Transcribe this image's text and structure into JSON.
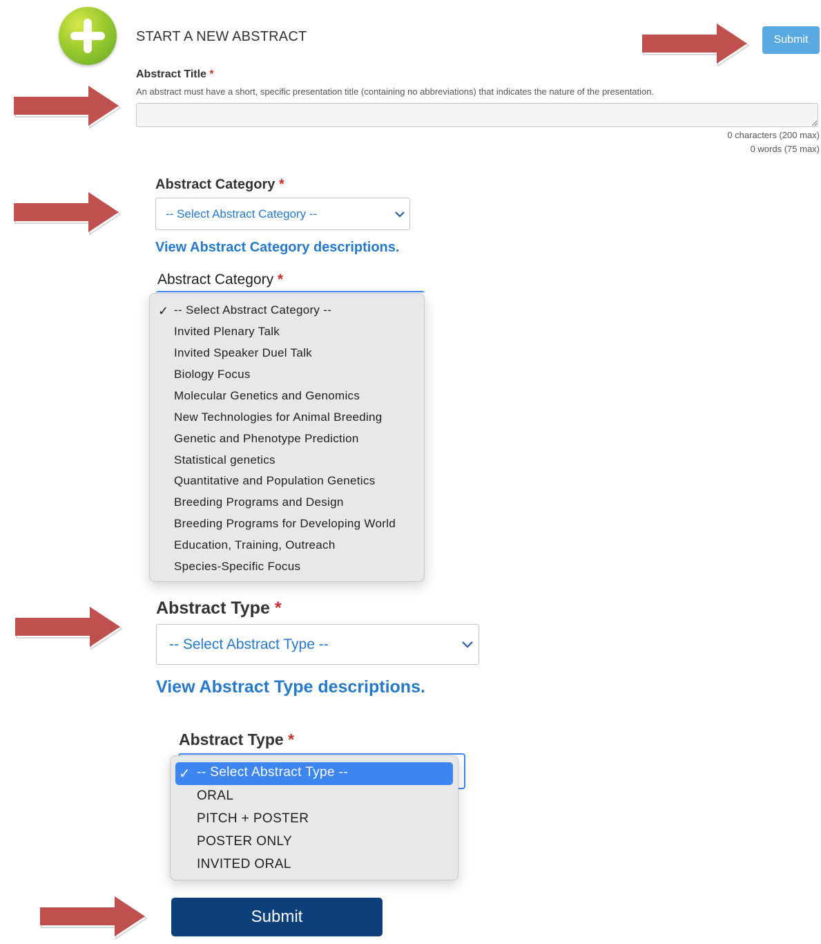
{
  "header": {
    "logo_icon": "plus-circle-icon",
    "title": "START A NEW ABSTRACT",
    "submit_label": "Submit"
  },
  "abstract_title": {
    "label": "Abstract Title",
    "required_mark": "*",
    "help": "An abstract must have a short, specific presentation title (containing no abbreviations) that indicates the nature of the presentation.",
    "value": "",
    "char_count": "0 characters (200 max)",
    "word_count": "0 words (75 max)"
  },
  "category_select": {
    "label": "Abstract Category",
    "required_mark": "*",
    "selected": "-- Select Abstract Category --",
    "descriptions_link": "View Abstract Category descriptions."
  },
  "category_dropdown": {
    "label": "Abstract Category",
    "required_mark": "*",
    "check_icon": "checkmark-icon",
    "options": [
      "-- Select Abstract Category --",
      "Invited Plenary Talk",
      "Invited Speaker Duel Talk",
      "Biology Focus",
      "Molecular Genetics and Genomics",
      "New Technologies for Animal Breeding",
      "Genetic and Phenotype Prediction",
      "Statistical genetics",
      "Quantitative and Population Genetics",
      "Breeding Programs and Design",
      "Breeding Programs for Developing World",
      "Education, Training, Outreach",
      "Species-Specific Focus"
    ]
  },
  "type_select": {
    "label": "Abstract Type",
    "required_mark": "*",
    "selected": "-- Select Abstract Type --",
    "descriptions_link": "View Abstract Type descriptions."
  },
  "type_dropdown": {
    "label": "Abstract Type",
    "required_mark": "*",
    "check_icon": "checkmark-icon",
    "options": [
      "-- Select Abstract Type --",
      "ORAL",
      "PITCH + POSTER",
      "POSTER ONLY",
      "INVITED ORAL"
    ]
  },
  "footer": {
    "submit_label": "Submit"
  },
  "colors": {
    "arrow": "#c0504d",
    "submit_top": "#5aa8e0",
    "submit_bottom": "#0d3f7a",
    "link": "#2878c8",
    "required": "#c9302c",
    "menu_highlight": "#3d86f0"
  }
}
